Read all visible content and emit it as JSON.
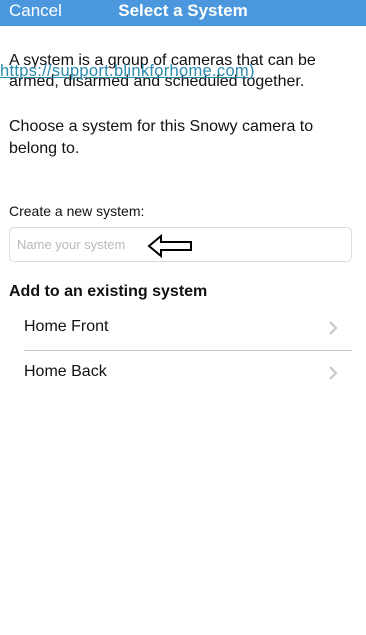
{
  "nav": {
    "cancel_label": "Cancel",
    "title": "Select a System"
  },
  "content": {
    "description": "A system is a group of cameras that can be armed, disarmed and scheduled together.",
    "overlay_link": "https://support.blinkforhome.com)",
    "choose_text": "Choose a system for this Snowy camera to belong to."
  },
  "create": {
    "label": "Create a new system:",
    "placeholder": "Name your system",
    "value": ""
  },
  "existing": {
    "title": "Add to an existing system",
    "items": [
      {
        "label": "Home Front"
      },
      {
        "label": "Home Back"
      }
    ]
  },
  "colors": {
    "navbar": "#4a97dd",
    "link": "#2a8bb0"
  },
  "icons": {
    "arrow": "left-arrow-icon",
    "chevron": "chevron-right-icon"
  }
}
